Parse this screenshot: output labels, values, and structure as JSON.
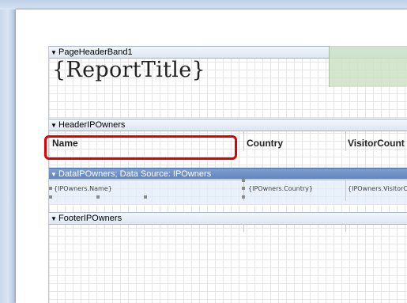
{
  "bands": {
    "page_header": "PageHeaderBand1",
    "header": "HeaderIPOwners",
    "data": "DataIPOwners; Data Source: IPOwners",
    "footer": "FooterIPOwners"
  },
  "report_title": "{ReportTitle}",
  "columns": {
    "name": "Name",
    "country": "Country",
    "visitor_count": "VisitorCount"
  },
  "data_cells": {
    "name": "{IPOwners.Name}",
    "country": "{IPOwners.Country}",
    "visitor_count": "{IPOwners.VisitorCount}"
  },
  "colors": {
    "selected_band": "#5f83bb",
    "highlight": "#e00000",
    "green_area": "#cde2c6"
  }
}
